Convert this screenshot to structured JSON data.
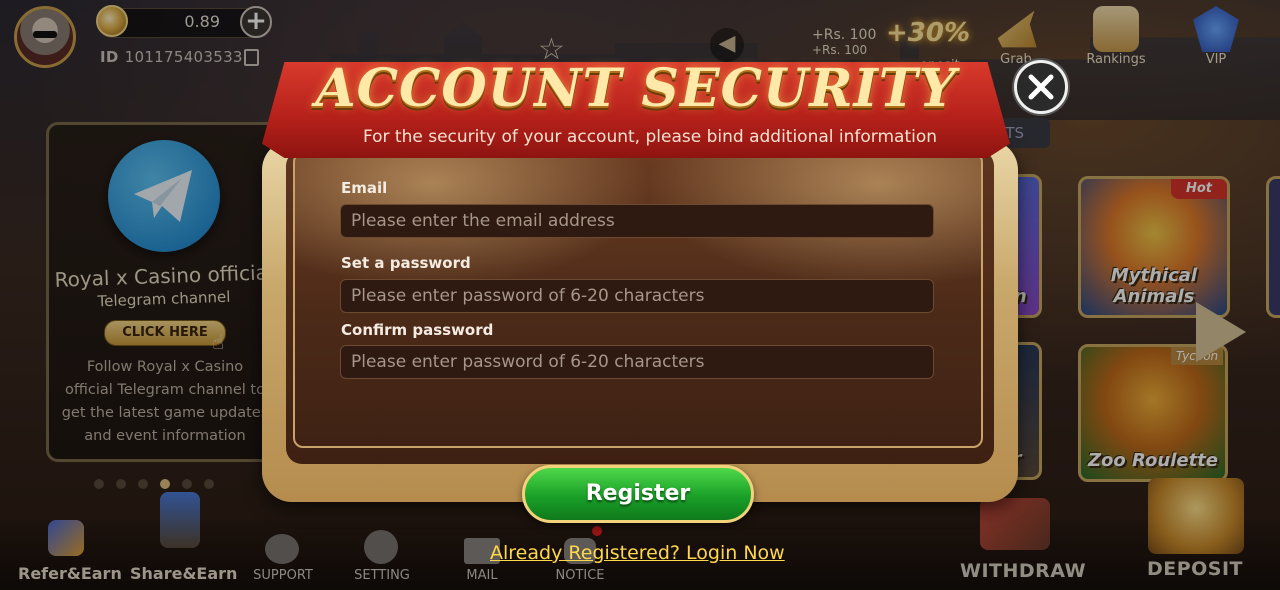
{
  "profile": {
    "balance": "0.89",
    "id_label": "ID",
    "id_value": "101175403533"
  },
  "top_icons": {
    "promo_line1": "+Rs. 100",
    "promo_line2": "+Rs. 100",
    "percent": "+30%",
    "deposit_fragment": "eposit",
    "grab": "Grab",
    "rankings": "Rankings",
    "vip": "VIP"
  },
  "telegram_card": {
    "title": "Royal x Casino official",
    "subtitle": "Telegram channel",
    "cta": "CLICK HERE",
    "description_lines": [
      "Follow Royal x Casino",
      "official Telegram channel to",
      "get the latest game updates",
      "and event information"
    ]
  },
  "games": {
    "hot_tag": "Hot",
    "tycoon_tag": "Tycoon",
    "mythical": "Mythical Animals",
    "zoo": "Zoo Roulette",
    "coin_fragment": "oin",
    "er_fragment": "er",
    "tab_fragment": "RTS"
  },
  "modal": {
    "title": "ACCOUNT SECURITY",
    "subtitle": "For the security of your account, please bind additional information",
    "email_label": "Email",
    "email_placeholder": "Please enter the email address",
    "password_label": "Set a password",
    "password_placeholder": "Please enter password of 6-20 characters",
    "confirm_label": "Confirm password",
    "confirm_placeholder": "Please enter password of 6-20 characters",
    "register": "Register",
    "login_link": "Already Registered? Login Now"
  },
  "bottom_nav": {
    "refer": "Refer&Earn",
    "share": "Share&Earn",
    "support": "SUPPORT",
    "setting": "SETTING",
    "mail": "MAIL",
    "notice": "NOTICE",
    "withdraw": "WITHDRAW",
    "deposit": "DEPOSIT"
  },
  "colors": {
    "accent_gold": "#ffe9a8",
    "banner_red": "#b4201a",
    "register_green": "#1aa028",
    "link_yellow": "#ffd84a"
  }
}
